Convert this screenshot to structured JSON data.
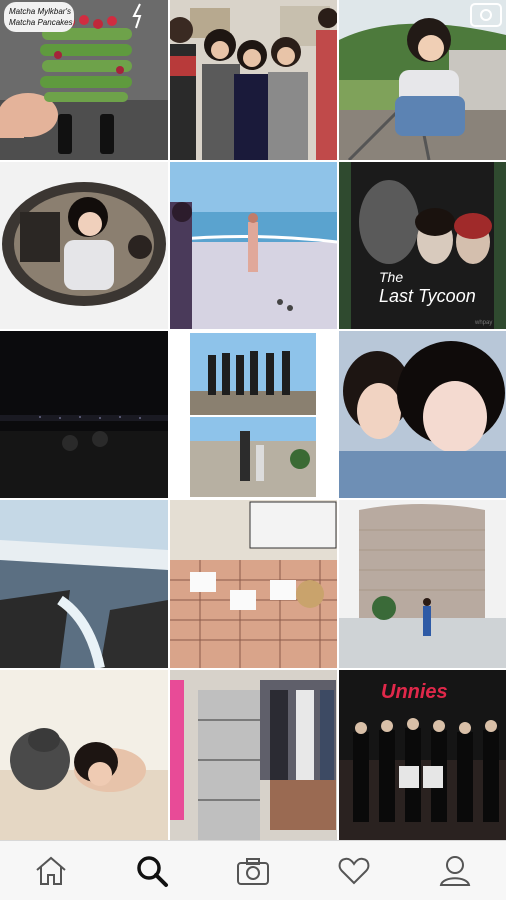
{
  "grid": {
    "tiles": [
      {
        "kind": "photo",
        "name": "matcha-pancakes-photo",
        "caption_1": "Matcha Mylkbar's",
        "caption_2": "Matcha Pancakes"
      },
      {
        "kind": "photo",
        "name": "group-selfie-photo"
      },
      {
        "kind": "video",
        "name": "railway-portrait-video",
        "badge_icon": "video-camera-icon"
      },
      {
        "kind": "photo",
        "name": "fisheye-portrait-photo"
      },
      {
        "kind": "photo",
        "name": "beach-photo"
      },
      {
        "kind": "photo",
        "name": "movie-poster-photo",
        "poster_title_1": "The",
        "poster_title_2": "Last Tycoon",
        "poster_footer": "whpay"
      },
      {
        "kind": "photo",
        "name": "night-city-view-photo"
      },
      {
        "kind": "photo",
        "name": "beach-collage-photo"
      },
      {
        "kind": "photo",
        "name": "two-girls-selfie-photo"
      },
      {
        "kind": "photo",
        "name": "waterfall-landscape-photo"
      },
      {
        "kind": "photo",
        "name": "market-stall-photo"
      },
      {
        "kind": "photo",
        "name": "museum-building-photo"
      },
      {
        "kind": "photo",
        "name": "girl-with-dog-photo"
      },
      {
        "kind": "photo",
        "name": "wardrobe-room-photo"
      },
      {
        "kind": "photo",
        "name": "unnies-poster-photo",
        "poster_title": "Unnies"
      }
    ]
  },
  "tabbar": {
    "tabs": [
      {
        "name": "home-tab",
        "icon": "home-icon",
        "active": false
      },
      {
        "name": "search-tab",
        "icon": "search-icon",
        "active": true
      },
      {
        "name": "camera-tab",
        "icon": "camera-icon",
        "active": false
      },
      {
        "name": "activity-tab",
        "icon": "heart-icon",
        "active": false
      },
      {
        "name": "profile-tab",
        "icon": "person-icon",
        "active": false
      }
    ]
  },
  "colors": {
    "tab_active": "#111111",
    "tab_inactive": "#555555",
    "tab_bg": "#f7f7f7"
  }
}
